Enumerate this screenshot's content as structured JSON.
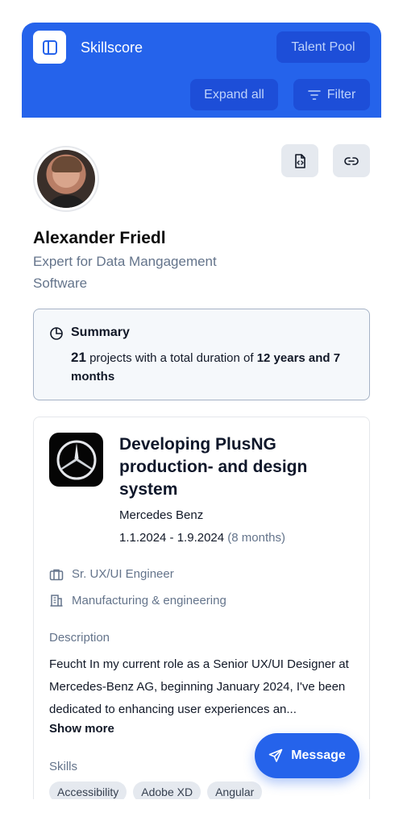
{
  "header": {
    "app_title": "Skillscore",
    "talent_pool_label": "Talent Pool",
    "expand_all_label": "Expand all",
    "filter_label": "Filter"
  },
  "profile": {
    "name": "Alexander Friedl",
    "role": "Expert for Data Mangagement Software",
    "actions": {
      "document_icon": "file-code-icon",
      "link_icon": "link-icon"
    }
  },
  "summary": {
    "title": "Summary",
    "projects_count": "21",
    "text_part1": " projects with a total duration of ",
    "duration": "12 years and 7 months"
  },
  "project": {
    "title": "Developing PlusNG production- and design system",
    "company": "Mercedes Benz",
    "date_range": "1.1.2024 - 1.9.2024",
    "duration": "(8 months)",
    "position": "Sr. UX/UI Engineer",
    "industry": "Manufacturing & engineering",
    "description_label": "Description",
    "description": "Feucht In my current role as a Senior UX/UI Designer at Mercedes-Benz AG, beginning January 2024, I've been dedicated to enhancing user experiences an...",
    "show_more_label": "Show more",
    "skills_label": "Skills",
    "skills": [
      "Accessibility",
      "Adobe XD",
      "Angular"
    ]
  },
  "fab": {
    "label": "Message"
  },
  "colors": {
    "accent": "#2563eb",
    "accent_dark": "#1d4ed8",
    "muted_text": "#64748b"
  }
}
